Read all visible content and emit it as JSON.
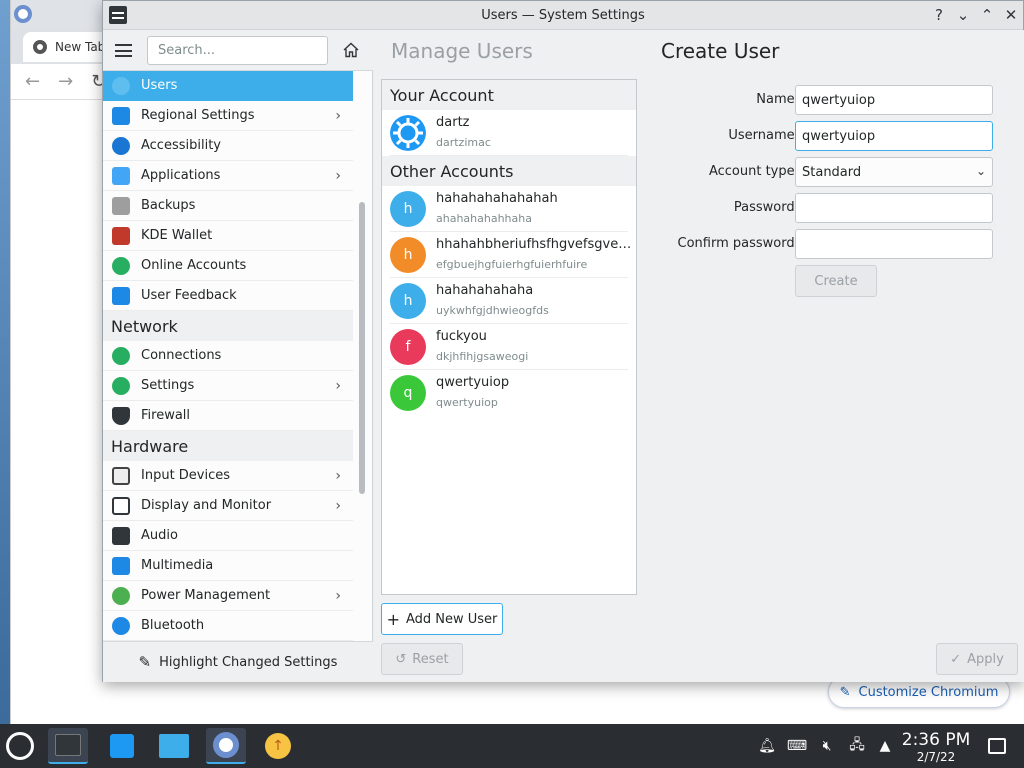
{
  "window": {
    "title": "Users — System Settings"
  },
  "chromium": {
    "tab_label": "New Tab",
    "customize_label": "Customize Chromium"
  },
  "sidebar": {
    "search_placeholder": "Search...",
    "items": [
      {
        "label": "Users",
        "selected": true,
        "icon_color": "#3daee9",
        "chevron": false
      },
      {
        "label": "Regional Settings",
        "icon_color": "#1e88e5",
        "chevron": true
      },
      {
        "label": "Accessibility",
        "icon_color": "#1976d2",
        "chevron": false
      },
      {
        "label": "Applications",
        "icon_color": "#42a5f5",
        "chevron": true
      },
      {
        "label": "Backups",
        "icon_color": "#757575",
        "chevron": false
      },
      {
        "label": "KDE Wallet",
        "icon_color": "#c0392b",
        "chevron": false
      },
      {
        "label": "Online Accounts",
        "icon_color": "#27ae60",
        "chevron": false
      },
      {
        "label": "User Feedback",
        "icon_color": "#1e88e5",
        "chevron": false
      }
    ],
    "network_header": "Network",
    "network_items": [
      {
        "label": "Connections",
        "icon_color": "#27ae60",
        "chevron": false
      },
      {
        "label": "Settings",
        "icon_color": "#27ae60",
        "chevron": true
      },
      {
        "label": "Firewall",
        "icon_color": "#31363b",
        "chevron": false
      }
    ],
    "hardware_header": "Hardware",
    "hardware_items": [
      {
        "label": "Input Devices",
        "icon_color": "#444",
        "chevron": true
      },
      {
        "label": "Display and Monitor",
        "icon_color": "#31363b",
        "chevron": true
      },
      {
        "label": "Audio",
        "icon_color": "#31363b",
        "chevron": false
      },
      {
        "label": "Multimedia",
        "icon_color": "#1e88e5",
        "chevron": false
      },
      {
        "label": "Power Management",
        "icon_color": "#4caf50",
        "chevron": true
      },
      {
        "label": "Bluetooth",
        "icon_color": "#1e88e5",
        "chevron": false
      }
    ],
    "footer_label": "Highlight Changed Settings"
  },
  "main": {
    "manage_title": "Manage Users",
    "create_title": "Create User",
    "your_account_header": "Your Account",
    "your_account": {
      "name": "dartz",
      "login": "dartzimac"
    },
    "other_accounts_header": "Other Accounts",
    "other_accounts": [
      {
        "initial": "h",
        "name": "hahahahahahahah",
        "login": "ahahahahahhaha",
        "color": "#3daee9"
      },
      {
        "initial": "h",
        "name": "hhahahbheriufhsfhgvefsgveh…",
        "login": "efgbuejhgfuierhgfuierhfuire",
        "color": "#f28c28"
      },
      {
        "initial": "h",
        "name": "hahahahahaha",
        "login": "uykwhfgjdhwieogfds",
        "color": "#3daee9"
      },
      {
        "initial": "f",
        "name": "fuckyou",
        "login": "dkjhfihjgsaweogi",
        "color": "#e93a5c"
      },
      {
        "initial": "q",
        "name": "qwertyuiop",
        "login": "qwertyuiop",
        "color": "#3ac83a"
      }
    ],
    "add_user_label": "Add New User",
    "reset_label": "Reset",
    "apply_label": "Apply",
    "form": {
      "name_label": "Name:",
      "name_value": "qwertyuiop",
      "username_label": "Username:",
      "username_value": "qwertyuiop",
      "account_type_label": "Account type:",
      "account_type_value": "Standard",
      "password_label": "Password:",
      "password_value": "",
      "confirm_label": "Confirm password:",
      "confirm_value": "",
      "create_label": "Create"
    }
  },
  "taskbar": {
    "time": "2:36 PM",
    "date": "2/7/22"
  }
}
